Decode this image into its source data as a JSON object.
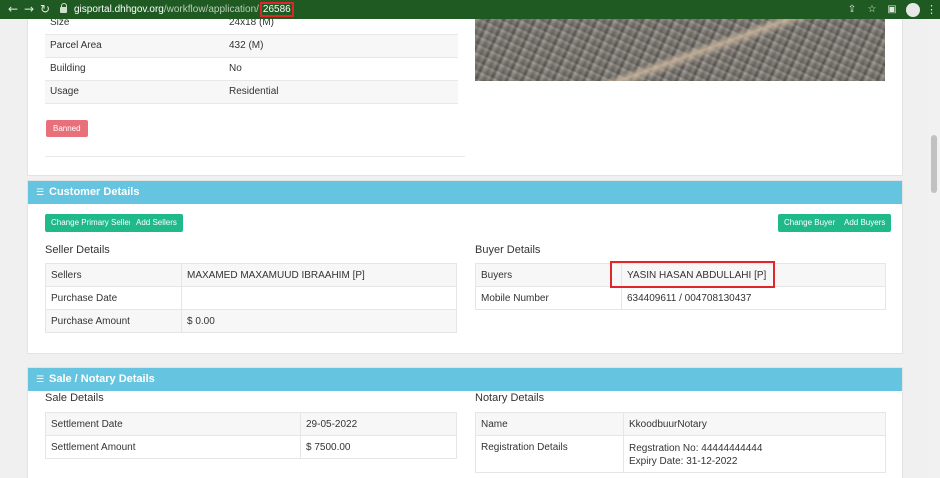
{
  "browser": {
    "url_host": "gisportal.dhhgov.org",
    "url_path": "/workflow/application/",
    "url_app_id": "26586"
  },
  "property": {
    "rows": [
      {
        "label": "Size",
        "value": "24x18 (M)"
      },
      {
        "label": "Parcel Area",
        "value": "432 (M)"
      },
      {
        "label": "Building",
        "value": "No"
      },
      {
        "label": "Usage",
        "value": "Residential"
      }
    ],
    "status_badge": "Banned"
  },
  "customer": {
    "header": "Customer Details",
    "buttons": {
      "change_primary_seller": "Change Primary Seller",
      "add_sellers": "Add Sellers",
      "change_buyer": "Change Buyer",
      "add_buyers": "Add Buyers"
    },
    "seller_title": "Seller Details",
    "seller_rows": [
      {
        "label": "Sellers",
        "value": "MAXAMED MAXAMUUD IBRAAHIM [P]"
      },
      {
        "label": "Purchase Date",
        "value": ""
      },
      {
        "label": "Purchase Amount",
        "value": "$ 0.00"
      }
    ],
    "buyer_title": "Buyer Details",
    "buyer_rows": [
      {
        "label": "Buyers",
        "value": "YASIN HASAN ABDULLAHI [P]"
      },
      {
        "label": "Mobile Number",
        "value": "634409611 / 004708130437"
      }
    ]
  },
  "sale": {
    "header": "Sale / Notary Details",
    "sale_title": "Sale Details",
    "sale_rows": [
      {
        "label": "Settlement Date",
        "value": "29-05-2022"
      },
      {
        "label": "Settlement Amount",
        "value": "$ 7500.00"
      }
    ],
    "notary_title": "Notary Details",
    "notary_name_label": "Name",
    "notary_name_value": "KkoodbuurNotary",
    "registration_label": "Registration Details",
    "registration_no": "Regstration No: 44444444444",
    "expiry_date": "Expiry Date: 31-12-2022"
  },
  "colors": {
    "browser_bar": "#1f5a22",
    "section_header": "#65c4e0",
    "primary_button": "#1fb98a",
    "banned_badge": "#e8707a",
    "highlight": "#e0262a"
  }
}
